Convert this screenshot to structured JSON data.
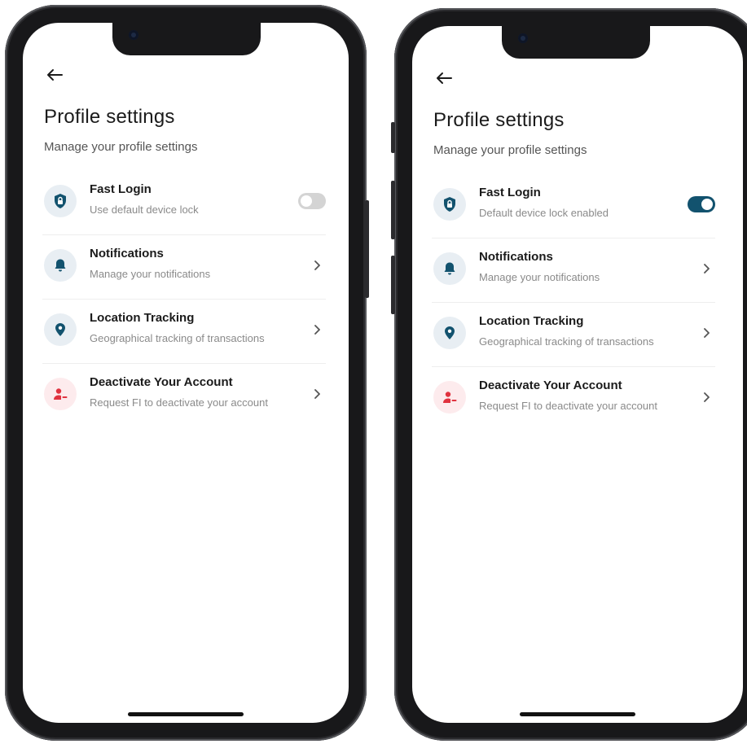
{
  "screens": [
    {
      "title": "Profile settings",
      "subtitle": "Manage your profile settings",
      "items": [
        {
          "title": "Fast Login",
          "subtitle": "Use default device lock",
          "icon": "shield-lock-icon",
          "control": "toggle",
          "toggle_on": false
        },
        {
          "title": "Notifications",
          "subtitle": "Manage your notifications",
          "icon": "bell-icon",
          "control": "chevron"
        },
        {
          "title": "Location Tracking",
          "subtitle": "Geographical tracking of transactions",
          "icon": "location-pin-icon",
          "control": "chevron"
        },
        {
          "title": "Deactivate Your Account",
          "subtitle": "Request FI to deactivate your account",
          "icon": "user-remove-icon",
          "control": "chevron"
        }
      ]
    },
    {
      "title": "Profile settings",
      "subtitle": "Manage your profile settings",
      "items": [
        {
          "title": "Fast Login",
          "subtitle": "Default device lock enabled",
          "icon": "shield-lock-icon",
          "control": "toggle",
          "toggle_on": true
        },
        {
          "title": "Notifications",
          "subtitle": "Manage your notifications",
          "icon": "bell-icon",
          "control": "chevron"
        },
        {
          "title": "Location Tracking",
          "subtitle": "Geographical tracking of transactions",
          "icon": "location-pin-icon",
          "control": "chevron"
        },
        {
          "title": "Deactivate Your Account",
          "subtitle": "Request FI to deactivate your account",
          "icon": "user-remove-icon",
          "control": "chevron"
        }
      ]
    }
  ],
  "colors": {
    "primary": "#12526e",
    "icon_bg": "#e8eef3",
    "danger": "#e0323f",
    "danger_bg": "#fdebed",
    "toggle_off": "#d4d4d4"
  }
}
